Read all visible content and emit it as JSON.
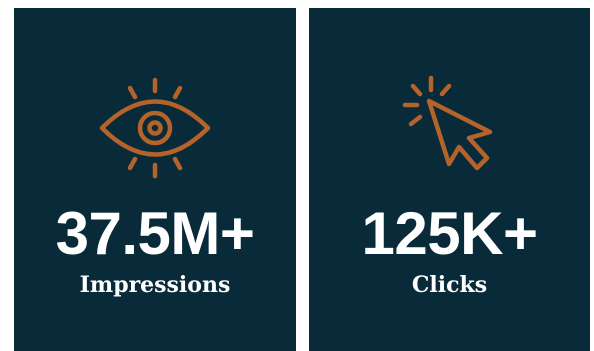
{
  "colors": {
    "card_background": "#092a38",
    "icon_accent": "#b4642a",
    "text": "#ffffff",
    "page_background": "#ffffff"
  },
  "stats": [
    {
      "icon": "eye-icon",
      "value": "37.5M+",
      "label": "Impressions"
    },
    {
      "icon": "cursor-click-icon",
      "value": "125K+",
      "label": "Clicks"
    }
  ]
}
